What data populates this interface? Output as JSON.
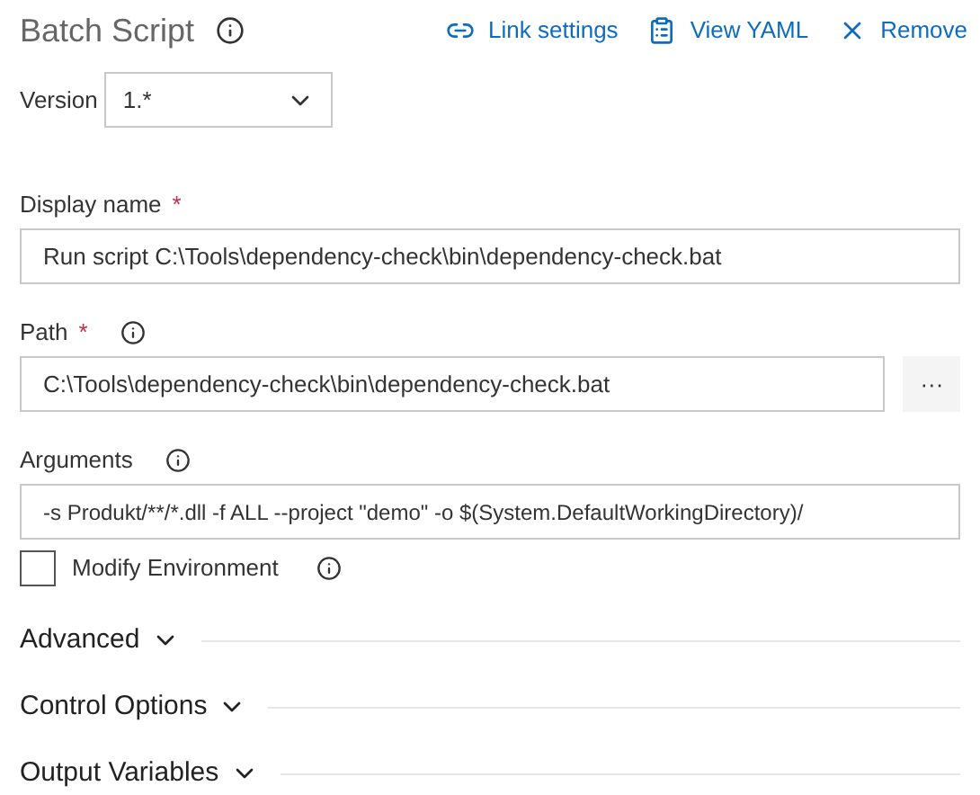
{
  "header": {
    "title": "Batch Script",
    "actions": [
      {
        "kind": "link",
        "label": "Link settings"
      },
      {
        "kind": "yaml",
        "label": "View YAML"
      },
      {
        "kind": "remove",
        "label": "Remove"
      }
    ]
  },
  "version": {
    "label": "Version",
    "value": "1.*"
  },
  "fields": [
    {
      "label": "Display name",
      "required_mark": "*",
      "info": false,
      "value": "Run script C:\\Tools\\dependency-check\\bin\\dependency-check.bat"
    },
    {
      "label": "Path",
      "required_mark": "*",
      "info": true,
      "browse_label": "···",
      "value": "C:\\Tools\\dependency-check\\bin\\dependency-check.bat"
    },
    {
      "label": "Arguments",
      "info": true,
      "value": "-s Produkt/**/*.dll -f ALL --project \"demo\" -o $(System.DefaultWorkingDirectory)/"
    }
  ],
  "checkbox": {
    "label": "Modify Environment",
    "checked": false
  },
  "sections": [
    {
      "label": "Advanced",
      "expanded": false
    },
    {
      "label": "Control Options",
      "expanded": false
    },
    {
      "label": "Output Variables",
      "expanded": false
    }
  ]
}
